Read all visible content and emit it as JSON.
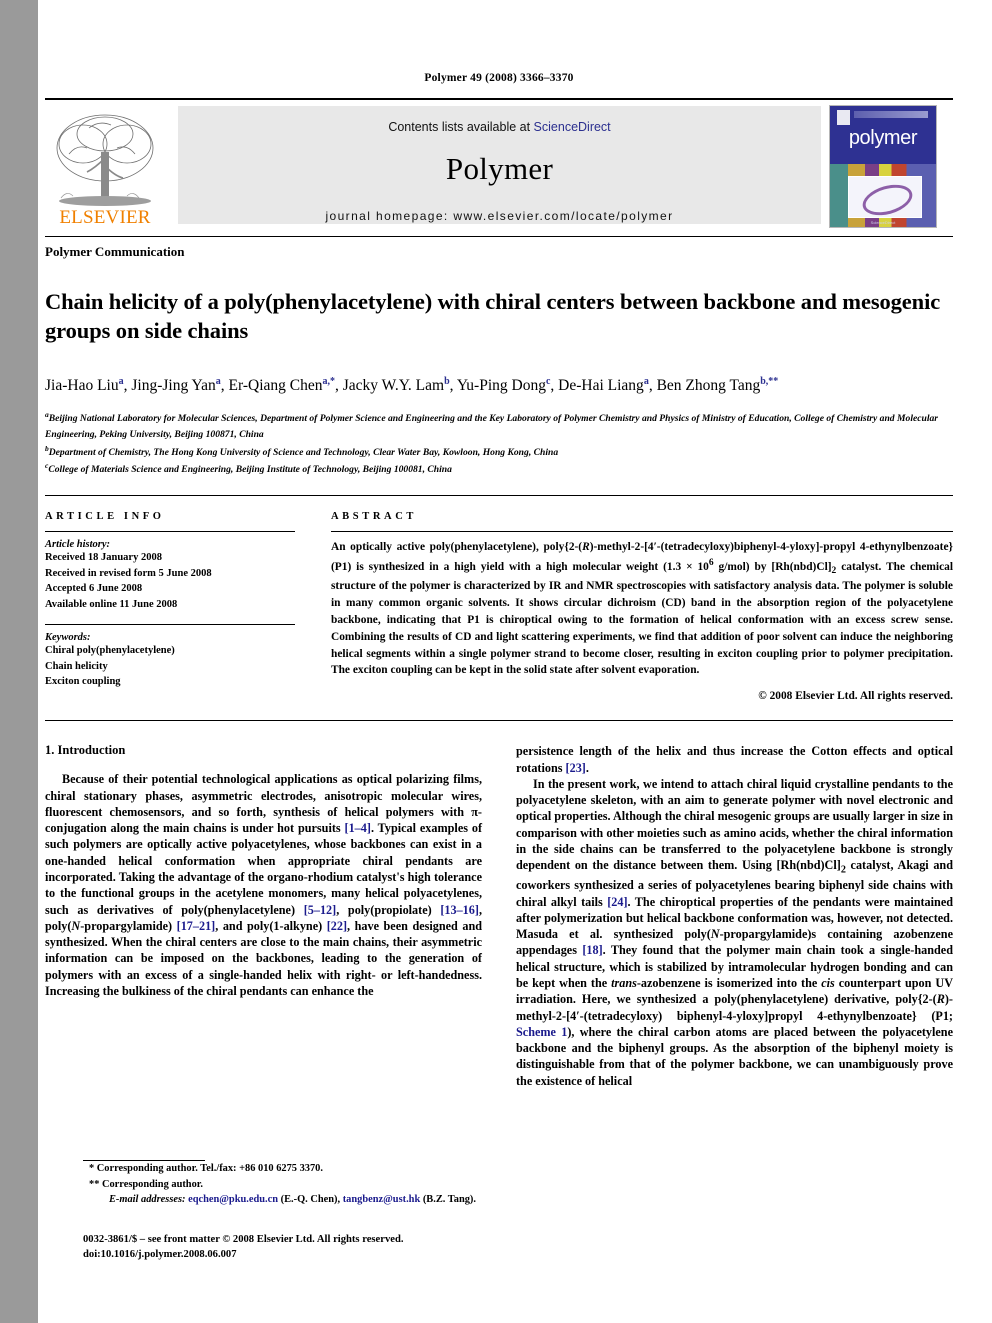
{
  "running_head": "Polymer 49 (2008) 3366–3370",
  "masthead": {
    "publisher_name": "ELSEVIER",
    "contents_prefix": "Contents lists available at ",
    "sciencedirect": "ScienceDirect",
    "journal_name": "Polymer",
    "homepage": "journal homepage: www.elsevier.com/locate/polymer",
    "cover_title": "polymer",
    "cover_footer": "ScienceDirect",
    "link_color": "#2b2f8f",
    "elsevier_orange": "#f08000"
  },
  "article": {
    "type": "Polymer Communication",
    "title": "Chain helicity of a poly(phenylacetylene) with chiral centers between backbone and mesogenic groups on side chains",
    "authors_html": "Jia-Hao Liu<sup>a</sup>, Jing-Jing Yan<sup>a</sup>, Er-Qiang Chen<sup>a,*</sup>, Jacky W.Y. Lam<sup>b</sup>, Yu-Ping Dong<sup>c</sup>, De-Hai Liang<sup>a</sup>, Ben Zhong Tang<sup>b,**</sup>",
    "affiliations": [
      "Beijing National Laboratory for Molecular Sciences, Department of Polymer Science and Engineering and the Key Laboratory of Polymer Chemistry and Physics of Ministry of Education, College of Chemistry and Molecular Engineering, Peking University, Beijing 100871, China",
      "Department of Chemistry, The Hong Kong University of Science and Technology, Clear Water Bay, Kowloon, Hong Kong, China",
      "College of Materials Science and Engineering, Beijing Institute of Technology, Beijing 100081, China"
    ],
    "affiliation_marks": [
      "a",
      "b",
      "c"
    ]
  },
  "article_info": {
    "heading": "ARTICLE INFO",
    "history_label": "Article history:",
    "history": [
      "Received 18 January 2008",
      "Received in revised form 5 June 2008",
      "Accepted 6 June 2008",
      "Available online 11 June 2008"
    ],
    "keywords_label": "Keywords:",
    "keywords": [
      "Chiral poly(phenylacetylene)",
      "Chain helicity",
      "Exciton coupling"
    ]
  },
  "abstract": {
    "heading": "ABSTRACT",
    "text_html": "An optically active poly(phenylacetylene), poly{2-(<i>R</i>)-methyl-2-[4′-(tetradecyloxy)biphenyl-4-yloxy]-propyl 4-ethynylbenzoate} (P1) is synthesized in a high yield with a high molecular weight (1.3 × 10<sup>6</sup> g/mol) by [Rh(nbd)Cl]<sub>2</sub> catalyst. The chemical structure of the polymer is characterized by IR and NMR spectroscopies with satisfactory analysis data. The polymer is soluble in many common organic solvents. It shows circular dichroism (CD) band in the absorption region of the polyacetylene backbone, indicating that P1 is chiroptical owing to the formation of helical conformation with an excess screw sense. Combining the results of CD and light scattering experiments, we find that addition of poor solvent can induce the neighboring helical segments within a single polymer strand to become closer, resulting in exciton coupling prior to polymer precipitation. The exciton coupling can be kept in the solid state after solvent evaporation.",
    "copyright": "© 2008 Elsevier Ltd. All rights reserved."
  },
  "body": {
    "section_number_title": "1. Introduction",
    "left_paragraphs_html": [
      "Because of their potential technological applications as optical polarizing films, chiral stationary phases, asymmetric electrodes, anisotropic molecular wires, fluorescent chemosensors, and so forth, synthesis of helical polymers with π-conjugation along the main chains is under hot pursuits <span class=\"ref\">[1–4]</span>. Typical examples of such polymers are optically active polyacetylenes, whose backbones can exist in a one-handed helical conformation when appropriate chiral pendants are incorporated. Taking the advantage of the organo-rhodium catalyst's high tolerance to the functional groups in the acetylene monomers, many helical polyacetylenes, such as derivatives of poly(phenylacetylene) <span class=\"ref\">[5–12]</span>, poly(propiolate) <span class=\"ref\">[13–16]</span>, poly(<i>N</i>-propargylamide) <span class=\"ref\">[17–21]</span>, and poly(1-alkyne) <span class=\"ref\">[22]</span>, have been designed and synthesized. When the chiral centers are close to the main chains, their asymmetric information can be imposed on the backbones, leading to the generation of polymers with an excess of a single-handed helix with right- or left-handedness. Increasing the bulkiness of the chiral pendants can enhance the"
    ],
    "right_paragraphs_html": [
      "persistence length of the helix and thus increase the Cotton effects and optical rotations <span class=\"ref\">[23]</span>.",
      "In the present work, we intend to attach chiral liquid crystalline pendants to the polyacetylene skeleton, with an aim to generate polymer with novel electronic and optical properties. Although the chiral mesogenic groups are usually larger in size in comparison with other moieties such as amino acids, whether the chiral information in the side chains can be transferred to the polyacetylene backbone is strongly dependent on the distance between them. Using [Rh(nbd)Cl]<sub>2</sub> catalyst, Akagi and coworkers synthesized a series of polyacetylenes bearing biphenyl side chains with chiral alkyl tails <span class=\"ref\">[24]</span>. The chiroptical properties of the pendants were maintained after polymerization but helical backbone conformation was, however, not detected. Masuda et al. synthesized poly(<i>N</i>-propargylamide)s containing azobenzene appendages <span class=\"ref\">[18]</span>. They found that the polymer main chain took a single-handed helical structure, which is stabilized by intramolecular hydrogen bonding and can be kept when the <i>trans</i>-azobenzene is isomerized into the <i>cis</i> counterpart upon UV irradiation. Here, we synthesized a poly(phenylacetylene) derivative, poly{2-(<i>R</i>)-methyl-2-[4′-(tetradecyloxy) biphenyl-4-yloxy]propyl 4-ethynylbenzoate} (P1; <span class=\"ref\">Scheme 1</span>), where the chiral carbon atoms are placed between the polyacetylene backbone and the biphenyl groups. As the absorption of the biphenyl moiety is distinguishable from that of the polymer backbone, we can unambiguously prove the existence of helical"
    ]
  },
  "footnotes": {
    "corresponding_1": "* Corresponding author. Tel./fax: +86 010 6275 3370.",
    "corresponding_2": "** Corresponding author.",
    "email_label": "E-mail addresses:",
    "email_1": "eqchen@pku.edu.cn",
    "email_1_name": "(E.-Q. Chen)",
    "email_2": "tangbenz@ust.hk",
    "email_2_name": "(B.Z. Tang)."
  },
  "imprint": {
    "line1": "0032-3861/$ – see front matter © 2008 Elsevier Ltd. All rights reserved.",
    "line2": "doi:10.1016/j.polymer.2008.06.007"
  }
}
